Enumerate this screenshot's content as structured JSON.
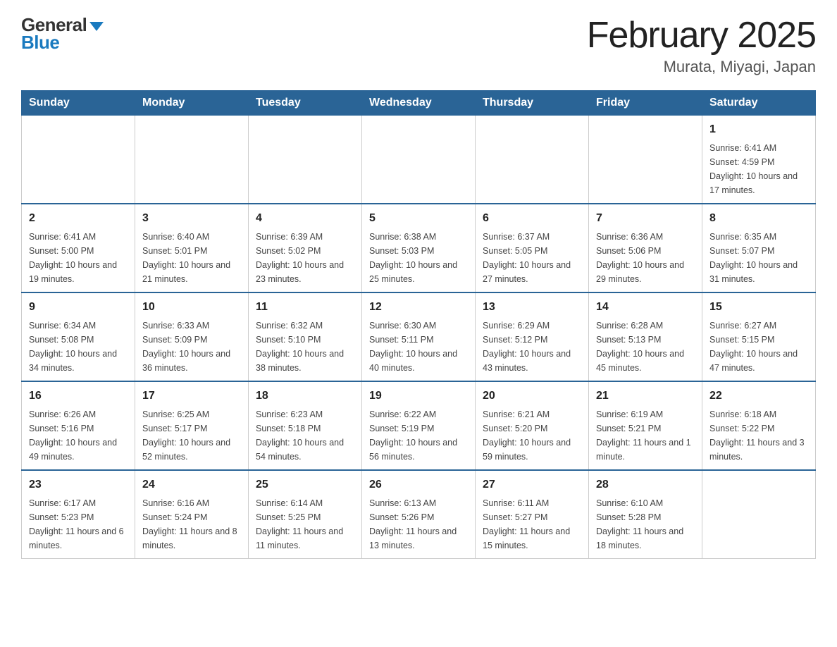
{
  "header": {
    "logo_general": "General",
    "logo_blue": "Blue",
    "month_title": "February 2025",
    "location": "Murata, Miyagi, Japan"
  },
  "weekdays": [
    "Sunday",
    "Monday",
    "Tuesday",
    "Wednesday",
    "Thursday",
    "Friday",
    "Saturday"
  ],
  "weeks": [
    [
      {
        "day": "",
        "info": ""
      },
      {
        "day": "",
        "info": ""
      },
      {
        "day": "",
        "info": ""
      },
      {
        "day": "",
        "info": ""
      },
      {
        "day": "",
        "info": ""
      },
      {
        "day": "",
        "info": ""
      },
      {
        "day": "1",
        "info": "Sunrise: 6:41 AM\nSunset: 4:59 PM\nDaylight: 10 hours and 17 minutes."
      }
    ],
    [
      {
        "day": "2",
        "info": "Sunrise: 6:41 AM\nSunset: 5:00 PM\nDaylight: 10 hours and 19 minutes."
      },
      {
        "day": "3",
        "info": "Sunrise: 6:40 AM\nSunset: 5:01 PM\nDaylight: 10 hours and 21 minutes."
      },
      {
        "day": "4",
        "info": "Sunrise: 6:39 AM\nSunset: 5:02 PM\nDaylight: 10 hours and 23 minutes."
      },
      {
        "day": "5",
        "info": "Sunrise: 6:38 AM\nSunset: 5:03 PM\nDaylight: 10 hours and 25 minutes."
      },
      {
        "day": "6",
        "info": "Sunrise: 6:37 AM\nSunset: 5:05 PM\nDaylight: 10 hours and 27 minutes."
      },
      {
        "day": "7",
        "info": "Sunrise: 6:36 AM\nSunset: 5:06 PM\nDaylight: 10 hours and 29 minutes."
      },
      {
        "day": "8",
        "info": "Sunrise: 6:35 AM\nSunset: 5:07 PM\nDaylight: 10 hours and 31 minutes."
      }
    ],
    [
      {
        "day": "9",
        "info": "Sunrise: 6:34 AM\nSunset: 5:08 PM\nDaylight: 10 hours and 34 minutes."
      },
      {
        "day": "10",
        "info": "Sunrise: 6:33 AM\nSunset: 5:09 PM\nDaylight: 10 hours and 36 minutes."
      },
      {
        "day": "11",
        "info": "Sunrise: 6:32 AM\nSunset: 5:10 PM\nDaylight: 10 hours and 38 minutes."
      },
      {
        "day": "12",
        "info": "Sunrise: 6:30 AM\nSunset: 5:11 PM\nDaylight: 10 hours and 40 minutes."
      },
      {
        "day": "13",
        "info": "Sunrise: 6:29 AM\nSunset: 5:12 PM\nDaylight: 10 hours and 43 minutes."
      },
      {
        "day": "14",
        "info": "Sunrise: 6:28 AM\nSunset: 5:13 PM\nDaylight: 10 hours and 45 minutes."
      },
      {
        "day": "15",
        "info": "Sunrise: 6:27 AM\nSunset: 5:15 PM\nDaylight: 10 hours and 47 minutes."
      }
    ],
    [
      {
        "day": "16",
        "info": "Sunrise: 6:26 AM\nSunset: 5:16 PM\nDaylight: 10 hours and 49 minutes."
      },
      {
        "day": "17",
        "info": "Sunrise: 6:25 AM\nSunset: 5:17 PM\nDaylight: 10 hours and 52 minutes."
      },
      {
        "day": "18",
        "info": "Sunrise: 6:23 AM\nSunset: 5:18 PM\nDaylight: 10 hours and 54 minutes."
      },
      {
        "day": "19",
        "info": "Sunrise: 6:22 AM\nSunset: 5:19 PM\nDaylight: 10 hours and 56 minutes."
      },
      {
        "day": "20",
        "info": "Sunrise: 6:21 AM\nSunset: 5:20 PM\nDaylight: 10 hours and 59 minutes."
      },
      {
        "day": "21",
        "info": "Sunrise: 6:19 AM\nSunset: 5:21 PM\nDaylight: 11 hours and 1 minute."
      },
      {
        "day": "22",
        "info": "Sunrise: 6:18 AM\nSunset: 5:22 PM\nDaylight: 11 hours and 3 minutes."
      }
    ],
    [
      {
        "day": "23",
        "info": "Sunrise: 6:17 AM\nSunset: 5:23 PM\nDaylight: 11 hours and 6 minutes."
      },
      {
        "day": "24",
        "info": "Sunrise: 6:16 AM\nSunset: 5:24 PM\nDaylight: 11 hours and 8 minutes."
      },
      {
        "day": "25",
        "info": "Sunrise: 6:14 AM\nSunset: 5:25 PM\nDaylight: 11 hours and 11 minutes."
      },
      {
        "day": "26",
        "info": "Sunrise: 6:13 AM\nSunset: 5:26 PM\nDaylight: 11 hours and 13 minutes."
      },
      {
        "day": "27",
        "info": "Sunrise: 6:11 AM\nSunset: 5:27 PM\nDaylight: 11 hours and 15 minutes."
      },
      {
        "day": "28",
        "info": "Sunrise: 6:10 AM\nSunset: 5:28 PM\nDaylight: 11 hours and 18 minutes."
      },
      {
        "day": "",
        "info": ""
      }
    ]
  ]
}
